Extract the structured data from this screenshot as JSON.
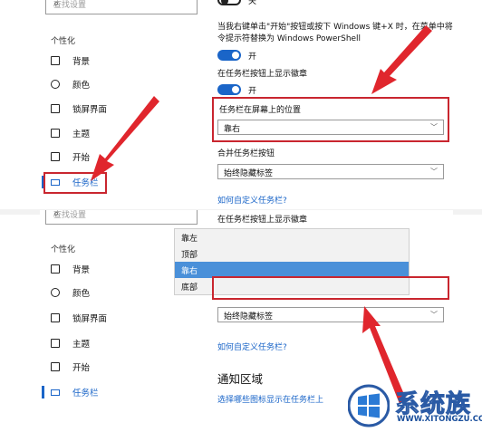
{
  "top": {
    "search_placeholder": "查找设置",
    "sidebar_section": "个性化",
    "nav": [
      {
        "label": "背景",
        "icon": "picture-icon"
      },
      {
        "label": "颜色",
        "icon": "palette-icon"
      },
      {
        "label": "锁屏界面",
        "icon": "lock-screen-icon"
      },
      {
        "label": "主题",
        "icon": "theme-icon"
      },
      {
        "label": "开始",
        "icon": "start-icon"
      },
      {
        "label": "任务栏",
        "icon": "taskbar-icon",
        "active": true
      }
    ],
    "first_toggle_label": "关",
    "powershell_text_line1": "当我右键单击\"开始\"按钮或按下 Windows 键+X 时，在菜单中将命",
    "powershell_text_line2": "令提示符替换为 Windows PowerShell",
    "powershell_toggle_label": "开",
    "badges_title": "在任务栏按钮上显示徽章",
    "badges_toggle_label": "开",
    "position_title": "任务栏在屏幕上的位置",
    "position_value": "靠右",
    "combine_title": "合并任务栏按钮",
    "combine_value": "始终隐藏标签",
    "customize_link": "如何自定义任务栏?"
  },
  "bottom": {
    "search_placeholder": "查找设置",
    "sidebar_section": "个性化",
    "nav": [
      {
        "label": "背景",
        "icon": "picture-icon"
      },
      {
        "label": "颜色",
        "icon": "palette-icon"
      },
      {
        "label": "锁屏界面",
        "icon": "lock-screen-icon"
      },
      {
        "label": "主题",
        "icon": "theme-icon"
      },
      {
        "label": "开始",
        "icon": "start-icon"
      },
      {
        "label": "任务栏",
        "icon": "taskbar-icon",
        "active": true
      }
    ],
    "badges_title": "在任务栏按钮上显示徽章",
    "dropdown_options": [
      "靠左",
      "顶部",
      "靠右",
      "底部"
    ],
    "dropdown_selected": "靠右",
    "combine_value": "始终隐藏标签",
    "customize_link": "如何自定义任务栏?",
    "notification_heading": "通知区域",
    "notification_link": "选择哪些图标显示在任务栏上"
  },
  "watermark": {
    "brand": "系统族",
    "domain": "WWW.XITONGZU.COM"
  },
  "colors": {
    "accent": "#1a65c8",
    "highlight": "#c9262f",
    "selected_option": "#4a90d9"
  }
}
